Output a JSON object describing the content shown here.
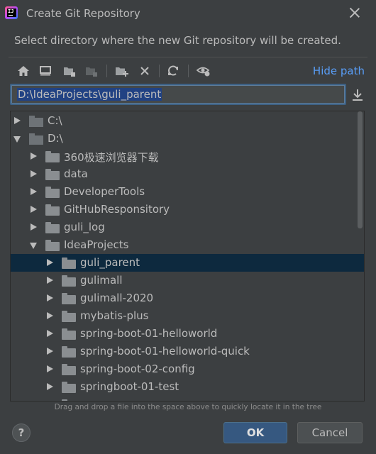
{
  "window": {
    "title": "Create Git Repository"
  },
  "description": "Select directory where the new Git repository will be created.",
  "toolbar": {
    "hide_path_label": "Hide path",
    "icons": [
      "home-icon",
      "desktop-icon",
      "project-folder-icon",
      "module-folder-icon",
      "new-folder-icon",
      "delete-icon",
      "refresh-icon",
      "show-hidden-icon"
    ]
  },
  "path": {
    "value": "D:\\IdeaProjects\\guli_parent"
  },
  "tree": {
    "items": [
      {
        "label": "C:\\",
        "depth": 0,
        "expanded": false,
        "kind": "drive",
        "selected": false
      },
      {
        "label": "D:\\",
        "depth": 0,
        "expanded": true,
        "kind": "drive",
        "selected": false
      },
      {
        "label": "360极速浏览器下载",
        "depth": 1,
        "expanded": false,
        "kind": "folder",
        "selected": false
      },
      {
        "label": "data",
        "depth": 1,
        "expanded": false,
        "kind": "folder",
        "selected": false
      },
      {
        "label": "DeveloperTools",
        "depth": 1,
        "expanded": false,
        "kind": "folder",
        "selected": false
      },
      {
        "label": "GitHubResponsitory",
        "depth": 1,
        "expanded": false,
        "kind": "folder",
        "selected": false
      },
      {
        "label": "guli_log",
        "depth": 1,
        "expanded": false,
        "kind": "folder",
        "selected": false
      },
      {
        "label": "IdeaProjects",
        "depth": 1,
        "expanded": true,
        "kind": "folder",
        "selected": false
      },
      {
        "label": "guli_parent",
        "depth": 2,
        "expanded": false,
        "kind": "folder",
        "selected": true
      },
      {
        "label": "gulimall",
        "depth": 2,
        "expanded": false,
        "kind": "folder",
        "selected": false
      },
      {
        "label": "gulimall-2020",
        "depth": 2,
        "expanded": false,
        "kind": "folder",
        "selected": false
      },
      {
        "label": "mybatis-plus",
        "depth": 2,
        "expanded": false,
        "kind": "folder",
        "selected": false
      },
      {
        "label": "spring-boot-01-helloworld",
        "depth": 2,
        "expanded": false,
        "kind": "folder",
        "selected": false
      },
      {
        "label": "spring-boot-01-helloworld-quick",
        "depth": 2,
        "expanded": false,
        "kind": "folder",
        "selected": false
      },
      {
        "label": "spring-boot-02-config",
        "depth": 2,
        "expanded": false,
        "kind": "folder",
        "selected": false
      },
      {
        "label": "springboot-01-test",
        "depth": 2,
        "expanded": false,
        "kind": "folder",
        "selected": false
      },
      {
        "label": "",
        "depth": 2,
        "expanded": false,
        "kind": "folder",
        "selected": false
      }
    ]
  },
  "hint": "Drag and drop a file into the space above to quickly locate it in the tree",
  "buttons": {
    "help": "?",
    "ok": "OK",
    "cancel": "Cancel"
  },
  "colors": {
    "accent": "#589df6",
    "selection": "#0d293e",
    "path_highlight": "#214283",
    "background": "#3c3f41"
  }
}
